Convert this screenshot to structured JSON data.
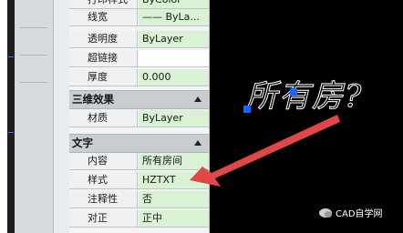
{
  "properties": {
    "top_partial": {
      "key": "打印样式",
      "value": "ByColor"
    },
    "rows_general": [
      {
        "key": "线宽",
        "value": "—— ByLa..."
      },
      {
        "key": "透明度",
        "value": "ByLayer"
      },
      {
        "key": "超链接",
        "value": ""
      },
      {
        "key": "厚度",
        "value": "0.000"
      }
    ],
    "section_3d": {
      "title": "三维效果"
    },
    "rows_3d": [
      {
        "key": "材质",
        "value": "ByLayer"
      }
    ],
    "section_text": {
      "title": "文字"
    },
    "rows_text": [
      {
        "key": "内容",
        "value": "所有房间"
      },
      {
        "key": "样式",
        "value": "HZTXT"
      },
      {
        "key": "注释性",
        "value": "否"
      },
      {
        "key": "对正",
        "value": "正中"
      }
    ]
  },
  "canvas": {
    "text": "所有房?",
    "grip_color": "#1565ff",
    "arrow_color": "#e04848"
  },
  "watermark": {
    "label": "CAD自学网"
  }
}
